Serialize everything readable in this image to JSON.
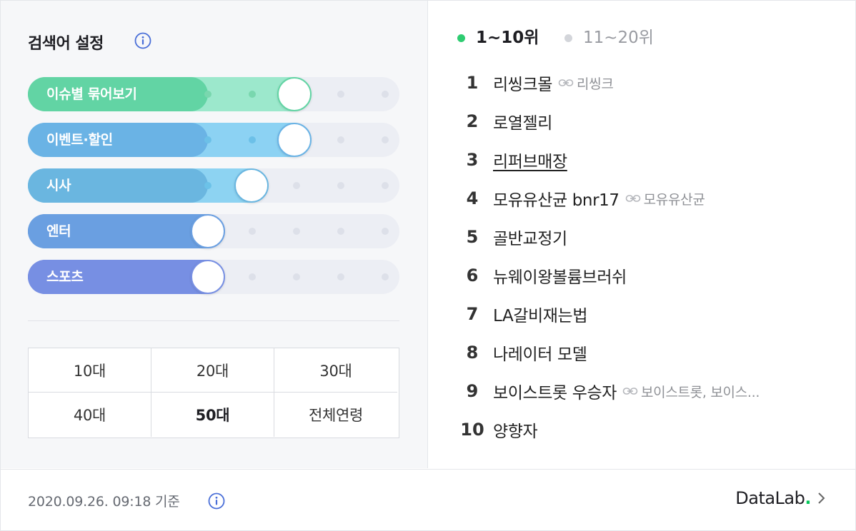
{
  "settings": {
    "title": "검색어 설정",
    "sliders": [
      {
        "label": "이슈별 묶어보기",
        "color": "#62d4a4",
        "light": "#9ce8cc",
        "dotColor": "#79d7ae",
        "level": 0.4
      },
      {
        "label": "이벤트·할인",
        "color": "#6ab3e5",
        "light": "#8cd2f3",
        "dotColor": "#6cc0e8",
        "level": 0.4
      },
      {
        "label": "시사",
        "color": "#6ab6e0",
        "light": "#8dd3f2",
        "dotColor": "#6cc2e8",
        "level": 0.2
      },
      {
        "label": "엔터",
        "color": "#6a9fe1",
        "light": "#6a9fe1",
        "dotColor": "#6a9fe1",
        "level": 0
      },
      {
        "label": "스포츠",
        "color": "#778fe3",
        "light": "#778fe3",
        "dotColor": "#778fe3",
        "level": 0
      }
    ],
    "ages": [
      "10대",
      "20대",
      "30대",
      "40대",
      "50대",
      "전체연령"
    ],
    "selected_age": "50대"
  },
  "tabs": [
    {
      "label": "1~10위",
      "active": true,
      "dot": "#2ecc71"
    },
    {
      "label": "11~20위",
      "active": false,
      "dot": "#d3d5da"
    }
  ],
  "ranking": [
    {
      "rank": "1",
      "keyword": "리씽크몰",
      "related": "리씽크"
    },
    {
      "rank": "2",
      "keyword": "로열젤리",
      "related": ""
    },
    {
      "rank": "3",
      "keyword": "리퍼브매장",
      "related": "",
      "underline": true
    },
    {
      "rank": "4",
      "keyword": "모유유산균 bnr17",
      "related": "모유유산균"
    },
    {
      "rank": "5",
      "keyword": "골반교정기",
      "related": ""
    },
    {
      "rank": "6",
      "keyword": "뉴웨이왕볼륨브러쉬",
      "related": ""
    },
    {
      "rank": "7",
      "keyword": "LA갈비재는법",
      "related": ""
    },
    {
      "rank": "8",
      "keyword": "나레이터 모델",
      "related": ""
    },
    {
      "rank": "9",
      "keyword": "보이스트롯 우승자",
      "related": "보이스트롯, 보이스..."
    },
    {
      "rank": "10",
      "keyword": "양향자",
      "related": ""
    }
  ],
  "footer": {
    "timestamp": "2020.09.26. 09:18 기준",
    "brand": "DataLab",
    "brand_dot": "."
  }
}
